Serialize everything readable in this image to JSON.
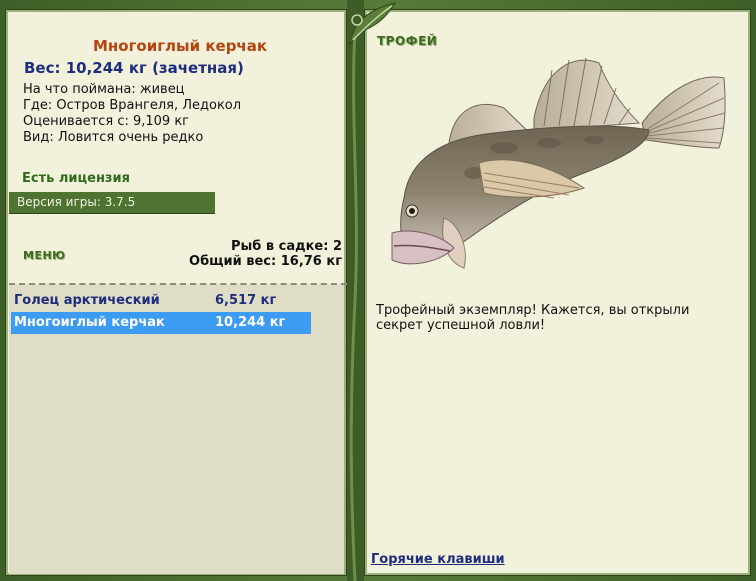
{
  "fish": {
    "name": "Многоиглый керчак",
    "weight_line": "Вес: 10,244 кг (зачетная)",
    "details": [
      "На что поймана: живец",
      "Где: Остров Врангеля, Ледокол",
      "Оценивается с: 9,109 кг",
      "Вид: Ловится очень редко"
    ]
  },
  "license_label": "Есть лицензия",
  "version_text": "Версия игры: 3.7.5",
  "menu_label": "МЕНЮ",
  "keepnet": {
    "count_text": "Рыб в садке: 2",
    "total_text": "Общий вес: 16,76 кг"
  },
  "catches": [
    {
      "name": "Голец арктический",
      "weight": "6,517 кг",
      "selected": false
    },
    {
      "name": "Многоиглый керчак",
      "weight": "10,244 кг",
      "selected": true
    }
  ],
  "trophy": {
    "label": "ТРОФЕЙ",
    "text": "Трофейный экземпляр! Кажется, вы открыли секрет успешной ловли!"
  },
  "hotkeys_link": "Горячие клавиши",
  "colors": {
    "frame_green": "#4a6b2e",
    "panel_bg": "#f2f2dc",
    "selected_row": "#3c9bf2",
    "name_orange": "#b5440e",
    "navy_text": "#1f2d7e"
  },
  "icons": {
    "fish_image": "sculpin-fish-illustration",
    "corner": "vine-leaf-decoration"
  }
}
